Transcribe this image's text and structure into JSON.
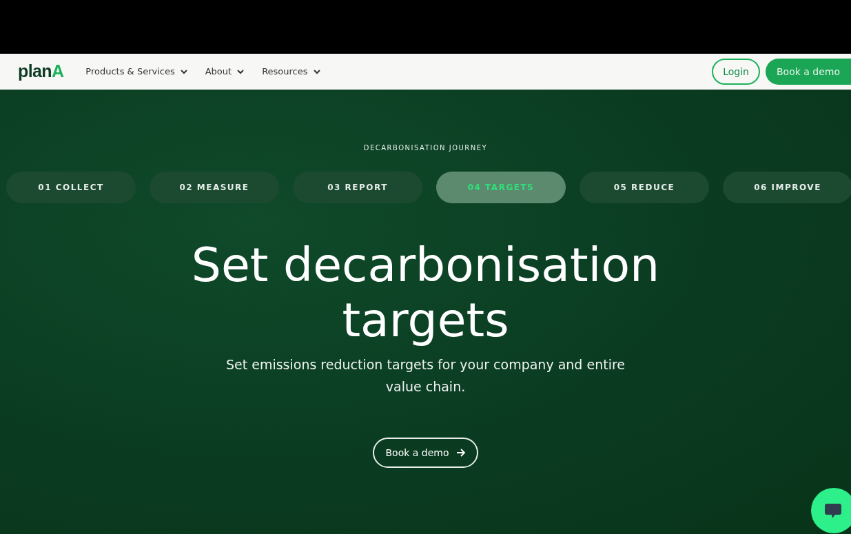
{
  "header": {
    "logo": {
      "text": "plan",
      "accent": "A"
    },
    "nav": [
      {
        "label": "Products & Services"
      },
      {
        "label": "About"
      },
      {
        "label": "Resources"
      }
    ],
    "login": "Login",
    "cta": "Book a demo"
  },
  "hero": {
    "eyebrow": "DECARBONISATION JOURNEY",
    "steps": [
      {
        "label": "01 COLLECT",
        "selected": false
      },
      {
        "label": "02 MEASURE",
        "selected": false
      },
      {
        "label": "03 REPORT",
        "selected": false
      },
      {
        "label": "04 TARGETS",
        "selected": true
      },
      {
        "label": "05 REDUCE",
        "selected": false
      },
      {
        "label": "06 IMPROVE",
        "selected": false
      }
    ],
    "title": "Set decarbonisation targets",
    "subtitle": "Set emissions reduction targets for your company and entire value chain.",
    "button": "Book a demo"
  }
}
